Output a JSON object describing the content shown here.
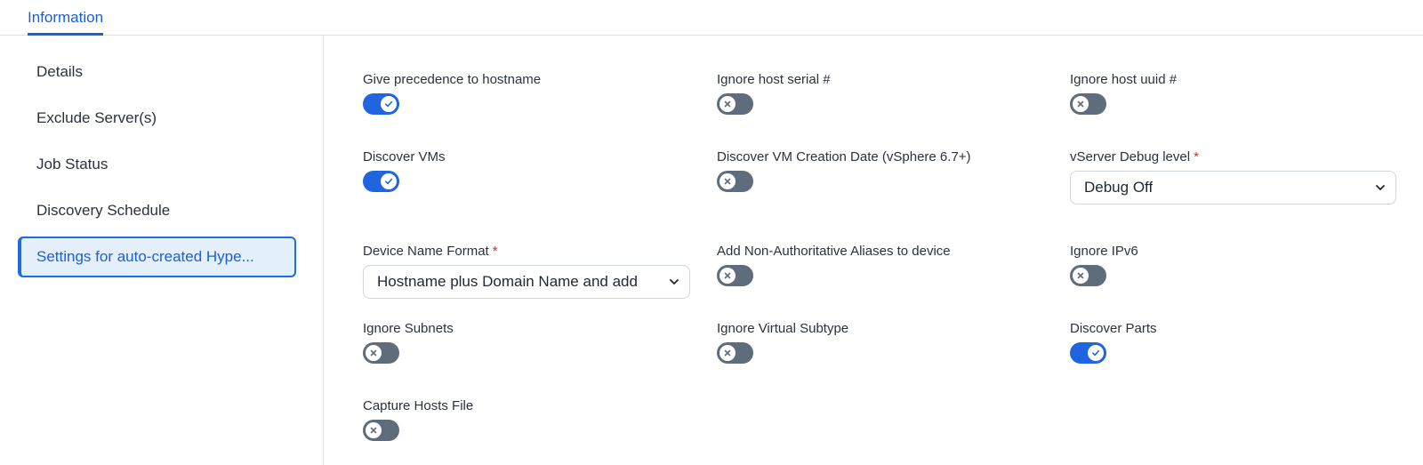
{
  "tabs": [
    {
      "label": "Information"
    }
  ],
  "sidebar": {
    "items": [
      {
        "label": "Details"
      },
      {
        "label": "Exclude Server(s)"
      },
      {
        "label": "Job Status"
      },
      {
        "label": "Discovery Schedule"
      },
      {
        "label": "Settings for auto-created Hype..."
      }
    ],
    "active_index": 4
  },
  "fields": {
    "give_precedence_hostname": {
      "label": "Give precedence to hostname",
      "value": true
    },
    "ignore_host_serial": {
      "label": "Ignore host serial #",
      "value": false
    },
    "ignore_host_uuid": {
      "label": "Ignore host uuid #",
      "value": false
    },
    "discover_vms": {
      "label": "Discover VMs",
      "value": true
    },
    "discover_vm_creation_date": {
      "label": "Discover VM Creation Date (vSphere 6.7+)",
      "value": false
    },
    "vserver_debug_level": {
      "label": "vServer Debug level",
      "required": "*",
      "value": "Debug Off"
    },
    "device_name_format": {
      "label": "Device Name Format",
      "required": "*",
      "value": "Hostname plus Domain Name and add"
    },
    "add_non_authoritative_aliases": {
      "label": "Add Non-Authoritative Aliases to device",
      "value": false
    },
    "ignore_ipv6": {
      "label": "Ignore IPv6",
      "value": false
    },
    "ignore_subnets": {
      "label": "Ignore Subnets",
      "value": false
    },
    "ignore_virtual_subtype": {
      "label": "Ignore Virtual Subtype",
      "value": false
    },
    "discover_parts": {
      "label": "Discover Parts",
      "value": true
    },
    "capture_hosts_file": {
      "label": "Capture Hosts File",
      "value": false
    }
  },
  "colors": {
    "accent": "#1b5fd6",
    "toggle_on": "#2164e0",
    "toggle_off": "#5f6c7c",
    "required": "#d6262e",
    "active_bg": "#e3effb"
  },
  "icons": {
    "toggle_on": "check-icon",
    "toggle_off": "x-icon",
    "select": "chevron-down-icon"
  }
}
